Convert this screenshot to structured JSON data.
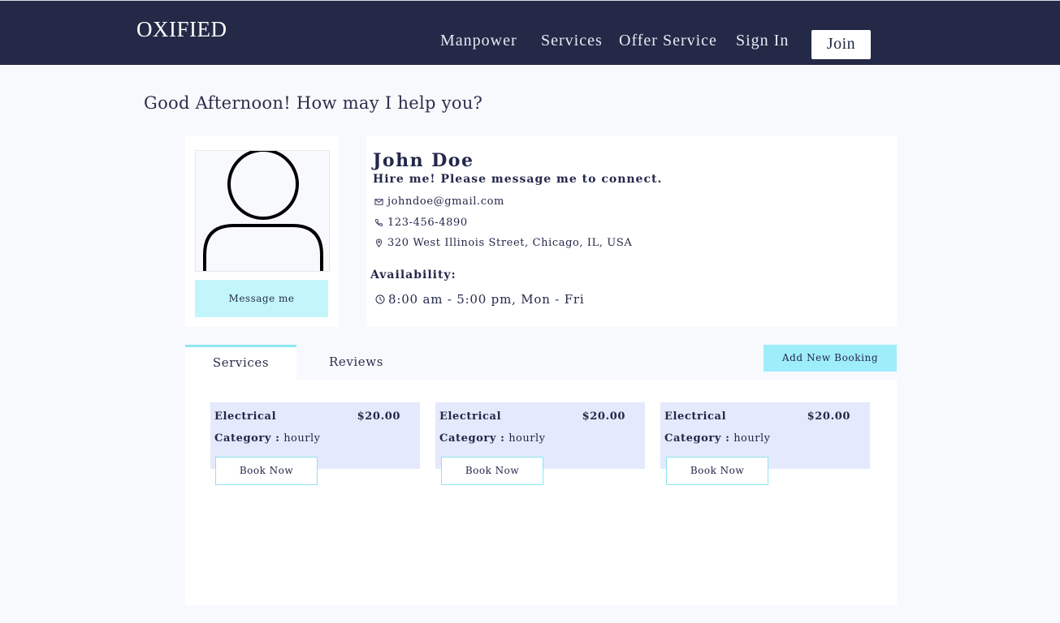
{
  "nav": {
    "logo": "OXIFIED",
    "links": [
      "Manpower",
      "Services",
      "Offer Service",
      "Sign In"
    ],
    "join_label": "Join"
  },
  "greeting": "Good Afternoon! How may I help you?",
  "profile": {
    "name": "John Doe",
    "tagline": "Hire me! Please message me to connect.",
    "email": "johndoe@gmail.com",
    "phone": "123-456-4890",
    "address": "320 West Illinois Street, Chicago, IL, USA",
    "availability_label": "Availability:",
    "availability": "8:00 am - 5:00 pm, Mon - Fri",
    "message_label": "Message me"
  },
  "tabs": {
    "items": [
      "Services",
      "Reviews"
    ],
    "active": "Services",
    "add_booking_label": "Add New Booking"
  },
  "services": [
    {
      "title": "Electrical",
      "price": "$20.00",
      "category_label": "Category :",
      "category": "hourly",
      "book_label": "Book Now"
    },
    {
      "title": "Electrical",
      "price": "$20.00",
      "category_label": "Category :",
      "category": "hourly",
      "book_label": "Book Now"
    },
    {
      "title": "Electrical",
      "price": "$20.00",
      "category_label": "Category :",
      "category": "hourly",
      "book_label": "Book Now"
    }
  ],
  "colors": {
    "navbar": "#242947",
    "accent_cyan": "#9eedfa",
    "card_blue": "#e4e9fb"
  }
}
